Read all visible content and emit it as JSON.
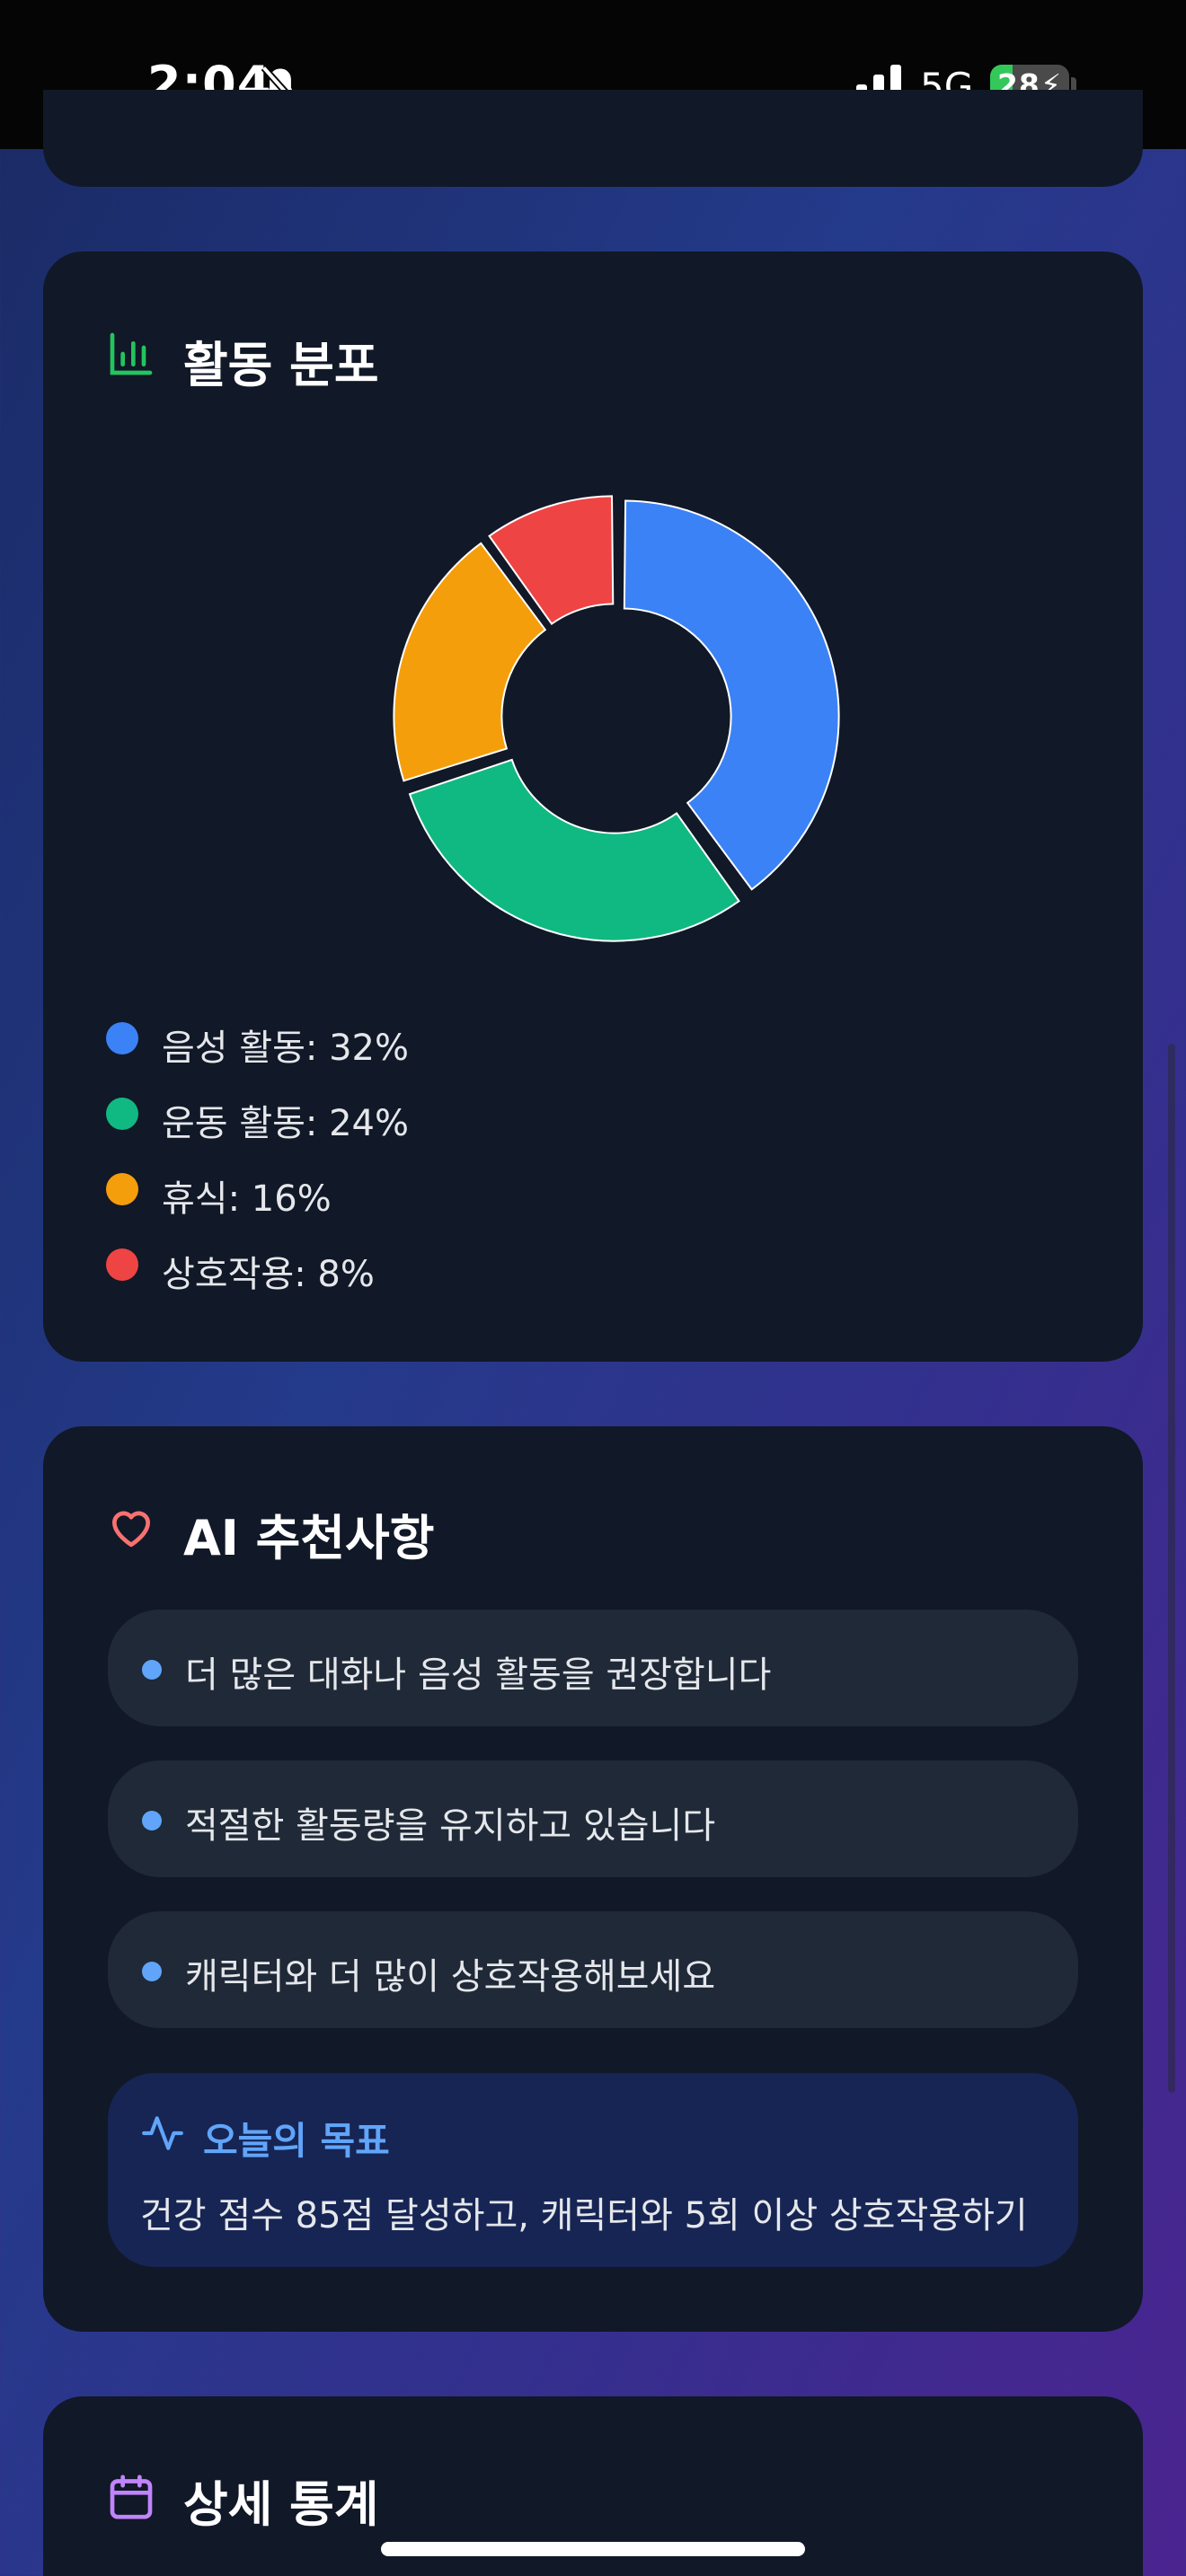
{
  "status_bar": {
    "time": "2:04",
    "network": "5G",
    "battery_level": 28,
    "battery_label": "28"
  },
  "activity_distribution": {
    "title": "활동 분포",
    "icon": "bar-chart-icon",
    "legend": [
      {
        "label": "음성 활동: 32%",
        "color": "#3b82f6"
      },
      {
        "label": "운동 활동: 24%",
        "color": "#10b981"
      },
      {
        "label": "휴식: 16%",
        "color": "#f59e0b"
      },
      {
        "label": "상호작용: 8%",
        "color": "#ef4444"
      }
    ]
  },
  "chart_data": {
    "type": "pie",
    "categories": [
      "음성 활동",
      "운동 활동",
      "휴식",
      "상호작용"
    ],
    "values": [
      32,
      24,
      16,
      8
    ],
    "colors": [
      "#3b82f6",
      "#10b981",
      "#f59e0b",
      "#ef4444"
    ],
    "title": "활동 분포",
    "donut": true,
    "legend_position": "bottom-left"
  },
  "ai_recommendations": {
    "title": "AI 추천사항",
    "icon": "heart-icon",
    "items": [
      {
        "text": "더 많은 대화나 음성 활동을 권장합니다"
      },
      {
        "text": "적절한 활동량을 유지하고 있습니다"
      },
      {
        "text": "캐릭터와 더 많이 상호작용해보세요"
      }
    ],
    "goal": {
      "title": "오늘의 목표",
      "icon": "activity-icon",
      "text": "건강 점수 85점 달성하고, 캐릭터와 5회 이상 상호작용하기"
    }
  },
  "detailed_stats": {
    "title": "상세 통계",
    "icon": "calendar-icon"
  },
  "colors": {
    "card_bg": "#111827",
    "item_bg": "#1f2937",
    "goal_bg": "#172554",
    "accent_blue": "#60a5fa",
    "chart_icon_green": "#22c55e",
    "heart_red": "#f87171",
    "calendar_purple": "#c084fc"
  }
}
